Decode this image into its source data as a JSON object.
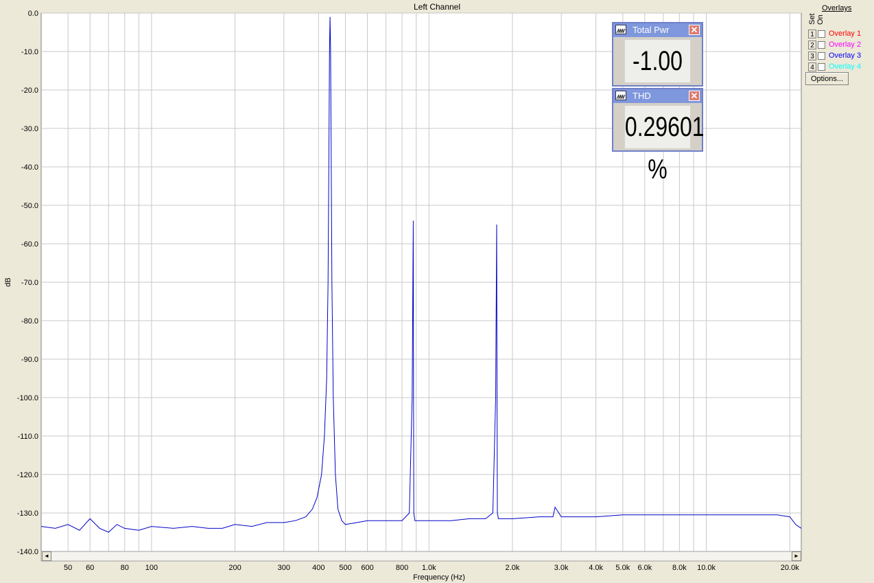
{
  "chart_data": {
    "type": "line",
    "title": "Left Channel",
    "xlabel": "Frequency (Hz)",
    "ylabel": "dB",
    "x_scale": "log",
    "xlim": [
      40,
      22000
    ],
    "ylim": [
      -140,
      0
    ],
    "grid": true,
    "y_ticks": [
      0,
      -10,
      -20,
      -30,
      -40,
      -50,
      -60,
      -70,
      -80,
      -90,
      -100,
      -110,
      -120,
      -130,
      -140
    ],
    "y_tick_labels": [
      "0.0",
      "-10.0",
      "-20.0",
      "-30.0",
      "-40.0",
      "-50.0",
      "-60.0",
      "-70.0",
      "-80.0",
      "-90.0",
      "-100.0",
      "-110.0",
      "-120.0",
      "-130.0",
      "-140.0"
    ],
    "x_ticks": [
      50,
      60,
      80,
      100,
      200,
      300,
      400,
      500,
      600,
      800,
      1000,
      2000,
      3000,
      4000,
      5000,
      6000,
      8000,
      10000,
      20000
    ],
    "x_tick_labels": [
      "50",
      "60",
      "80",
      "100",
      "200",
      "300",
      "400",
      "500",
      "600",
      "800",
      "1.0k",
      "2.0k",
      "3.0k",
      "4.0k",
      "5.0k",
      "6.0k",
      "8.0k",
      "10.0k",
      "20.0k"
    ],
    "series": [
      {
        "color": "#0000c8",
        "x": [
          40,
          45,
          50,
          55,
          60,
          65,
          70,
          75,
          80,
          90,
          100,
          120,
          140,
          160,
          180,
          200,
          230,
          260,
          300,
          330,
          360,
          380,
          395,
          410,
          420,
          428,
          433,
          436,
          438,
          440,
          442,
          444,
          447,
          452,
          460,
          470,
          485,
          500,
          550,
          600,
          700,
          800,
          850,
          870,
          878,
          880,
          882,
          890,
          920,
          1000,
          1200,
          1400,
          1600,
          1700,
          1740,
          1755,
          1760,
          1765,
          1780,
          1850,
          2000,
          2500,
          2800,
          2850,
          3000,
          4000,
          5000,
          6000,
          8000,
          10000,
          12000,
          15000,
          18000,
          20000,
          21000,
          22000
        ],
        "y": [
          -133.5,
          -134,
          -133,
          -134.5,
          -131.5,
          -134,
          -135,
          -133,
          -134,
          -134.5,
          -133.5,
          -134,
          -133.5,
          -134,
          -134,
          -133,
          -133.5,
          -132.5,
          -132.5,
          -132,
          -131,
          -129,
          -126,
          -120,
          -110,
          -95,
          -70,
          -35,
          -10,
          -1,
          -10,
          -35,
          -70,
          -100,
          -120,
          -129,
          -132,
          -133,
          -132.5,
          -132,
          -132,
          -132,
          -130,
          -100,
          -54,
          -100,
          -130,
          -132,
          -132,
          -132,
          -132,
          -131.5,
          -131.5,
          -130,
          -100,
          -55,
          -100,
          -130,
          -131.5,
          -131.5,
          -131.5,
          -131,
          -131,
          -128.5,
          -131,
          -131,
          -130.5,
          -130.5,
          -130.5,
          -130.5,
          -130.5,
          -130.5,
          -130.5,
          -131,
          -133,
          -134
        ]
      }
    ]
  },
  "meters": {
    "total_pwr": {
      "title": "Total Pwr",
      "value": "-1.00 dB",
      "close": "✕"
    },
    "thd": {
      "title": "THD",
      "value": "0.29601 %",
      "close": "✕"
    }
  },
  "overlays": {
    "heading": "Overlays",
    "set_label": "Set",
    "on_label": "On",
    "items": [
      {
        "num": "1",
        "label": "Overlay 1",
        "color": "#ff0000"
      },
      {
        "num": "2",
        "label": "Overlay 2",
        "color": "#ff00ff"
      },
      {
        "num": "3",
        "label": "Overlay 3",
        "color": "#0000ff"
      },
      {
        "num": "4",
        "label": "Overlay 4",
        "color": "#00ffff"
      }
    ],
    "options_label": "Options..."
  },
  "scroll": {
    "left": "◄",
    "right": "►"
  }
}
